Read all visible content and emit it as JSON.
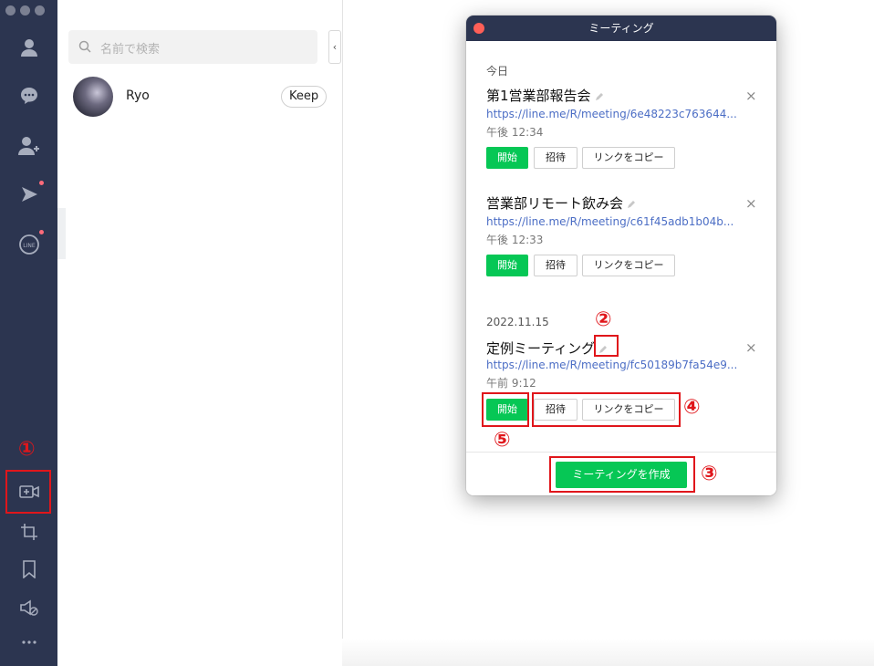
{
  "search": {
    "placeholder": "名前で検索"
  },
  "friends": [
    {
      "name": "Ryo",
      "keep_label": "Keep"
    }
  ],
  "collapse_glyph": "‹",
  "meeting_window": {
    "title": "ミーティング",
    "groups": [
      {
        "date": "今日",
        "meetings": [
          {
            "title": "第1営業部報告会",
            "link": "https://line.me/R/meeting/6e48223c763644...",
            "time": "午後 12:34"
          },
          {
            "title": "営業部リモート飲み会",
            "link": "https://line.me/R/meeting/c61f45adb1b04b...",
            "time": "午後 12:33"
          }
        ]
      },
      {
        "date": "2022.11.15",
        "meetings": [
          {
            "title": "定例ミーティング",
            "link": "https://line.me/R/meeting/fc50189b7fa54e9...",
            "time": "午前 9:12"
          }
        ]
      }
    ],
    "buttons": {
      "start": "開始",
      "invite": "招待",
      "copy_link": "リンクをコピー"
    },
    "delete_glyph": "×",
    "create_button": "ミーティングを作成"
  },
  "annotations": [
    "①",
    "②",
    "③",
    "④",
    "⑤"
  ],
  "colors": {
    "rail": "#2c3550",
    "accent_green": "#06c755",
    "annotation_red": "#e0161b",
    "link": "#4c6ec5"
  }
}
